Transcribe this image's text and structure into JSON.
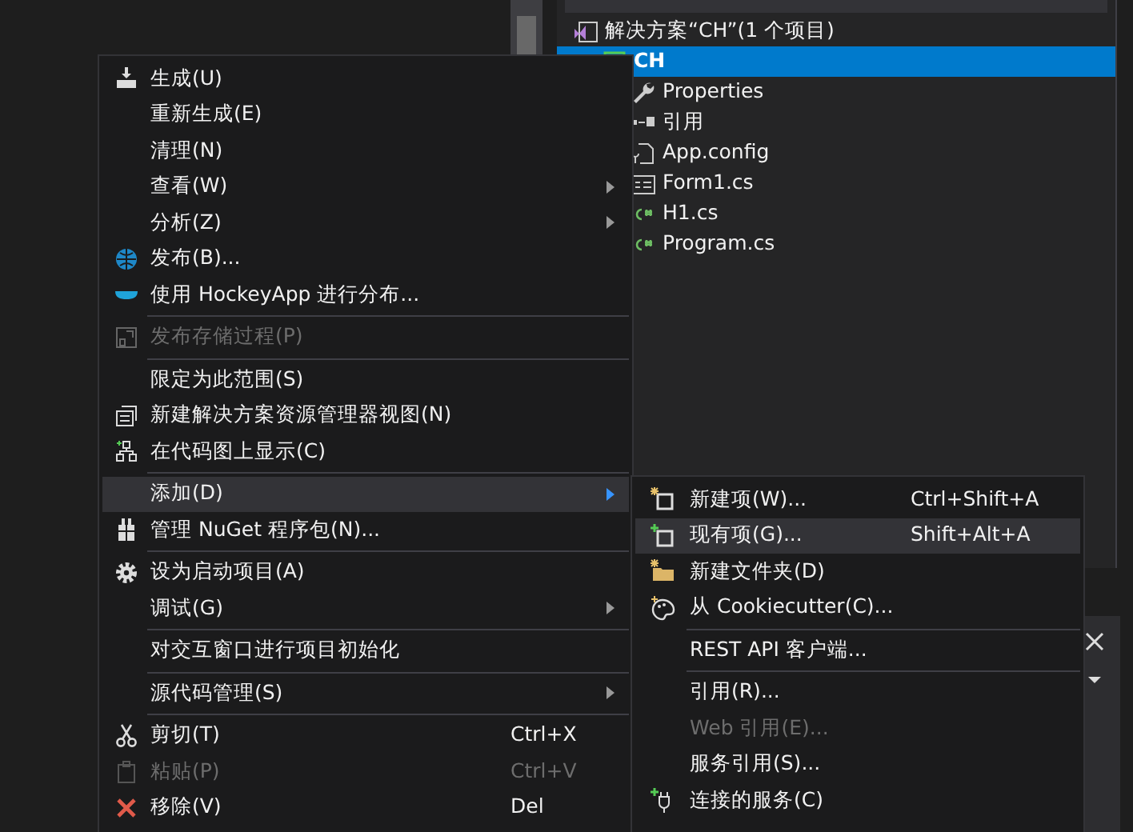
{
  "solution_explorer": {
    "items": [
      {
        "label": "解决方案“CH”(1 个项目)",
        "selected": false,
        "children": [
          {
            "label": "CH",
            "selected": true,
            "children": [
              {
                "label": "Properties",
                "selected": false
              },
              {
                "label": "引用",
                "selected": false
              },
              {
                "label": "App.config",
                "selected": false
              },
              {
                "label": "Form1.cs",
                "selected": false
              },
              {
                "label": "H1.cs",
                "selected": false
              },
              {
                "label": "Program.cs",
                "selected": false
              }
            ]
          }
        ]
      }
    ]
  },
  "context_menu": {
    "items": [
      {
        "kind": "item",
        "label": "生成(U)",
        "has_submenu": false,
        "disabled": false,
        "selected": false
      },
      {
        "kind": "item",
        "label": "重新生成(E)",
        "has_submenu": false,
        "disabled": false,
        "selected": false
      },
      {
        "kind": "item",
        "label": "清理(N)",
        "has_submenu": false,
        "disabled": false,
        "selected": false
      },
      {
        "kind": "item",
        "label": "查看(W)",
        "has_submenu": true,
        "disabled": false,
        "selected": false
      },
      {
        "kind": "item",
        "label": "分析(Z)",
        "has_submenu": true,
        "disabled": false,
        "selected": false
      },
      {
        "kind": "item",
        "label": "发布(B)...",
        "has_submenu": false,
        "disabled": false,
        "selected": false
      },
      {
        "kind": "item",
        "label": "使用 HockeyApp 进行分布...",
        "has_submenu": false,
        "disabled": false,
        "selected": false
      },
      {
        "kind": "separator"
      },
      {
        "kind": "item",
        "label": "发布存储过程(P)",
        "has_submenu": false,
        "disabled": true,
        "selected": false
      },
      {
        "kind": "separator"
      },
      {
        "kind": "item",
        "label": "限定为此范围(S)",
        "has_submenu": false,
        "disabled": false,
        "selected": false
      },
      {
        "kind": "item",
        "label": "新建解决方案资源管理器视图(N)",
        "has_submenu": false,
        "disabled": false,
        "selected": false
      },
      {
        "kind": "item",
        "label": "在代码图上显示(C)",
        "has_submenu": false,
        "disabled": false,
        "selected": false
      },
      {
        "kind": "separator"
      },
      {
        "kind": "item",
        "label": "添加(D)",
        "has_submenu": true,
        "disabled": false,
        "selected": true
      },
      {
        "kind": "item",
        "label": "管理 NuGet 程序包(N)...",
        "has_submenu": false,
        "disabled": false,
        "selected": false
      },
      {
        "kind": "separator"
      },
      {
        "kind": "item",
        "label": "设为启动项目(A)",
        "has_submenu": false,
        "disabled": false,
        "selected": false
      },
      {
        "kind": "item",
        "label": "调试(G)",
        "has_submenu": true,
        "disabled": false,
        "selected": false
      },
      {
        "kind": "separator"
      },
      {
        "kind": "item",
        "label": "对交互窗口进行项目初始化",
        "has_submenu": false,
        "disabled": false,
        "selected": false
      },
      {
        "kind": "separator"
      },
      {
        "kind": "item",
        "label": "源代码管理(S)",
        "has_submenu": true,
        "disabled": false,
        "selected": false
      },
      {
        "kind": "separator"
      },
      {
        "kind": "item",
        "label": "剪切(T)",
        "shortcut": "Ctrl+X",
        "has_submenu": false,
        "disabled": false,
        "selected": false
      },
      {
        "kind": "item",
        "label": "粘贴(P)",
        "shortcut": "Ctrl+V",
        "has_submenu": false,
        "disabled": true,
        "selected": false
      },
      {
        "kind": "item",
        "label": "移除(V)",
        "shortcut": "Del",
        "has_submenu": false,
        "disabled": false,
        "selected": false
      }
    ]
  },
  "add_submenu": {
    "items": [
      {
        "kind": "item",
        "label": "新建项(W)...",
        "shortcut": "Ctrl+Shift+A",
        "disabled": false,
        "selected": false
      },
      {
        "kind": "item",
        "label": "现有项(G)...",
        "shortcut": "Shift+Alt+A",
        "disabled": false,
        "selected": true
      },
      {
        "kind": "item",
        "label": "新建文件夹(D)",
        "disabled": false,
        "selected": false
      },
      {
        "kind": "item",
        "label": "从 Cookiecutter(C)...",
        "disabled": false,
        "selected": false
      },
      {
        "kind": "separator"
      },
      {
        "kind": "item",
        "label": "REST API 客户端...",
        "disabled": false,
        "selected": false
      },
      {
        "kind": "separator"
      },
      {
        "kind": "item",
        "label": "引用(R)...",
        "disabled": false,
        "selected": false
      },
      {
        "kind": "item",
        "label": "Web 引用(E)...",
        "disabled": true,
        "selected": false
      },
      {
        "kind": "item",
        "label": "服务引用(S)...",
        "disabled": false,
        "selected": false
      },
      {
        "kind": "item",
        "label": "连接的服务(C)",
        "disabled": false,
        "selected": false
      }
    ]
  }
}
